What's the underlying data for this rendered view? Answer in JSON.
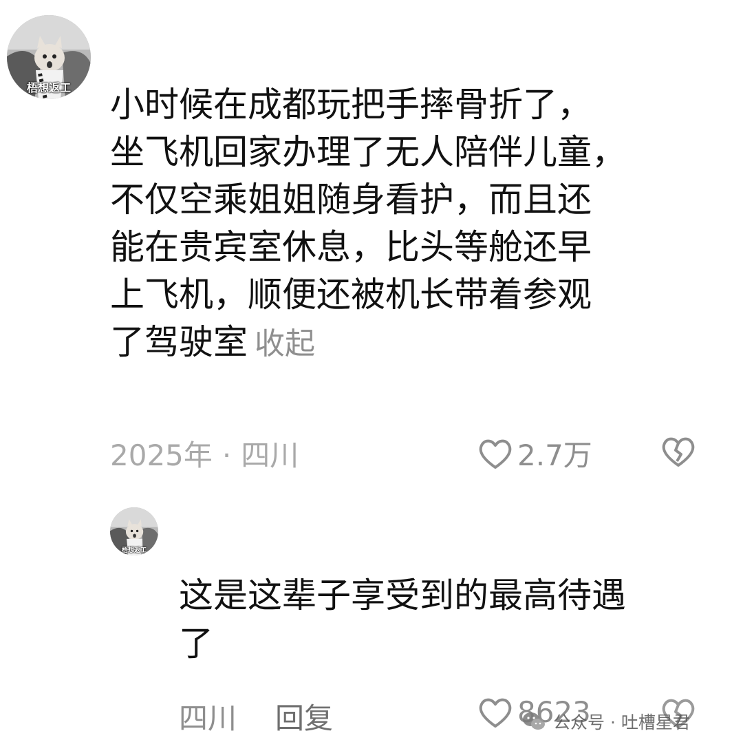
{
  "comment": {
    "avatar_caption": "梧想返工",
    "text_lines": [
      "小时候在成都玩把手摔骨折了，",
      "坐飞机回家办理了无人陪伴儿童，",
      "不仅空乘姐姐随身看护，而且还",
      "能在贵宾室休息，比头等舱还早",
      "上飞机，顺便还被机长带着参观",
      "了驾驶室"
    ],
    "collapse_label": "收起",
    "year": "2025年",
    "separator": "·",
    "location": "四川",
    "likes": "2.7万",
    "like_icon": "heart-outline-icon",
    "dislike_icon": "broken-heart-icon"
  },
  "reply": {
    "avatar_caption": "梧想返工",
    "text_lines": [
      "这是这辈子享受到的最高待遇",
      "了"
    ],
    "location": "四川",
    "reply_label": "回复",
    "likes": "8623",
    "like_icon": "heart-outline-icon",
    "dislike_icon": "broken-heart-icon"
  },
  "watermark": {
    "label": "公众号 · 吐槽星君",
    "icon": "wechat-icon"
  },
  "colors": {
    "text_primary": "#111111",
    "text_muted": "#a9a9a9",
    "icon_gray": "#8e8e8e",
    "background": "#ffffff"
  }
}
